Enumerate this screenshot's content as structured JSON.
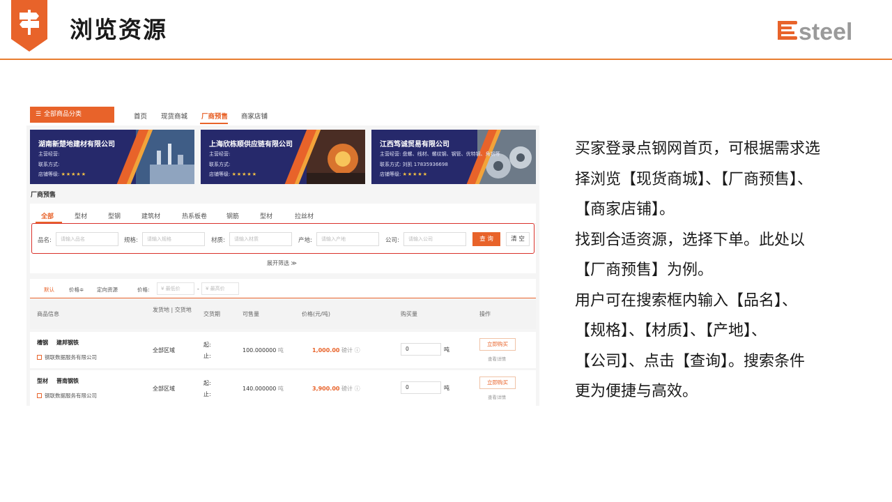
{
  "slide": {
    "title": "浏览资源",
    "logo_text": "steel",
    "accent_color": "#e87d2f",
    "icon": "signpost-icon"
  },
  "screenshot": {
    "nav": {
      "category_button": "全部商品分类",
      "links": [
        "首页",
        "现货商城",
        "厂商预售",
        "商家店铺"
      ],
      "active_link": "厂商预售"
    },
    "banners": [
      {
        "company": "湖南新楚地建材有限公司",
        "business": "主营经营:",
        "contact": "联系方式:",
        "rating_label": "店铺等级:",
        "stars": "★★★★★"
      },
      {
        "company": "上海欣栋顺供应链有限公司",
        "business": "主营经营:",
        "contact": "联系方式:",
        "rating_label": "店铺等级:",
        "stars": "★★★★★"
      },
      {
        "company": "江西笃诚贸易有限公司",
        "business": "主营经营: 盘螺、线材、螺纹钢、钢管、优特钢、角钢等",
        "contact": "联系方式: 刘凯 17835936698",
        "rating_label": "店铺等级:",
        "stars": "★★★★★"
      }
    ],
    "section_label": "厂商预售",
    "tabs": [
      "全部",
      "型材",
      "型钢",
      "建筑材",
      "热系板卷",
      "钢筋",
      "型材",
      "拉丝材"
    ],
    "active_tab": "全部",
    "search": {
      "fields": [
        {
          "label": "品名:",
          "placeholder": "请输入品名"
        },
        {
          "label": "规格:",
          "placeholder": "请输入规格"
        },
        {
          "label": "材质:",
          "placeholder": "请输入材质"
        },
        {
          "label": "产地:",
          "placeholder": "请输入产地"
        },
        {
          "label": "公司:",
          "placeholder": "请输入公司"
        }
      ],
      "query_button": "查 询",
      "clear_button": "清 空",
      "expand_label": "展开筛选 ≫"
    },
    "sort_bar": {
      "default": "默认",
      "price_sort": "价格≑",
      "directed": "定向资源",
      "price_label": "价格:",
      "min_placeholder": "¥ 最低价",
      "dash": "-",
      "max_placeholder": "¥ 最高价"
    },
    "table": {
      "headers": [
        "商品信息",
        "发货地 | 交货地",
        "交货期",
        "可售量",
        "价格(元/吨)",
        "购买量",
        "操作"
      ],
      "rows": [
        {
          "product": "槽钢",
          "brand": "建邦钢铁",
          "company": "钢联数据服务有限公司",
          "region": "全部区域",
          "start": "起:",
          "end": "止:",
          "quantity": "100.000000",
          "qty_unit": "吨",
          "price": "1,000.00",
          "price_note": "磅计 ⓘ",
          "buy_qty": "0",
          "buy_unit": "吨",
          "buy_button": "立即购买",
          "detail": "查看详情"
        },
        {
          "product": "型材",
          "brand": "晋南钢铁",
          "company": "钢联数据服务有限公司",
          "region": "全部区域",
          "start": "起:",
          "end": "止:",
          "quantity": "140.000000",
          "qty_unit": "吨",
          "price": "3,900.00",
          "price_note": "磅计 ⓘ",
          "buy_qty": "0",
          "buy_unit": "吨",
          "buy_button": "立即购买",
          "detail": "查看详情"
        }
      ]
    }
  },
  "description": {
    "lines": [
      "买家登录点钢网首页，可根据需求选",
      "择浏览【现货商城】、【厂商预售】、",
      "【商家店铺】。",
      "找到合适资源，选择下单。此处以",
      "【厂商预售】为例。",
      "用户可在搜索框内输入【品名】、",
      "【规格】、【材质】、【产地】、",
      "【公司】、点击【查询】。搜索条件",
      "更为便捷与高效。"
    ]
  }
}
